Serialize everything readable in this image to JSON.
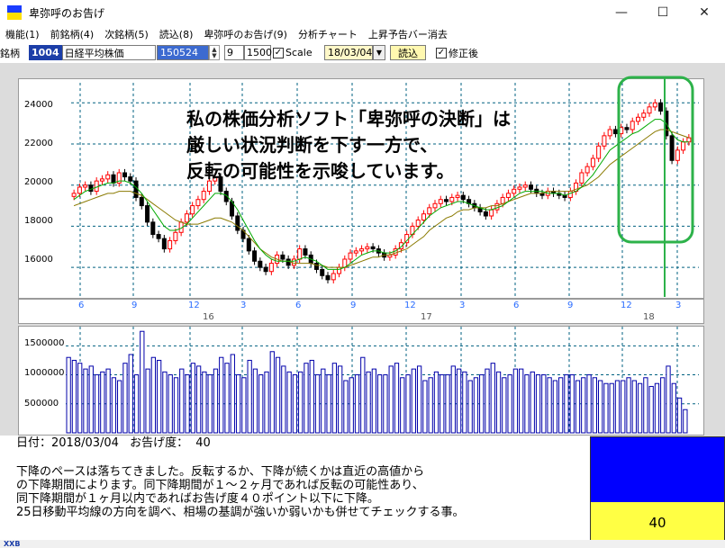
{
  "window": {
    "title": "卑弥呼のお告げ",
    "minimize": "—",
    "maximize": "☐",
    "close": "✕",
    "icon": "app-icon",
    "colors": {
      "top": "#1a3cff",
      "bottom": "#ffe000"
    }
  },
  "menu": [
    "機能(1)",
    "前銘柄(4)",
    "次銘柄(5)",
    "読込(8)",
    "卑弥呼のお告げ(9)",
    "分析チャート",
    "上昇予告バー消去"
  ],
  "toolbar": {
    "label": "銘柄",
    "code": "1004",
    "name": "日経平均株価",
    "selected": "150524",
    "field1": "9",
    "field2": "1500",
    "scale_checked": true,
    "scale_label": "Scale",
    "date": "18/03/04",
    "load_button": "読込",
    "adjust_checked": true,
    "adjust_label": "修正後"
  },
  "chart_data": {
    "type": "candlestick",
    "price_axis": {
      "ticks": [
        "24000",
        "22000",
        "20000",
        "18000",
        "16000"
      ],
      "range": [
        15000,
        24800
      ]
    },
    "month_ticks": [
      "6",
      "9",
      "12",
      "3",
      "6",
      "9",
      "12",
      "3",
      "6",
      "9",
      "12",
      "3"
    ],
    "year_ticks": [
      "16",
      "17",
      "18"
    ],
    "volume_axis": {
      "ticks": [
        "1500000",
        "1000000",
        "500000"
      ]
    },
    "colors": {
      "up": "#ff0000",
      "down": "#000000",
      "ma_short": "#00aa00",
      "ma_long": "#8a7a00",
      "grid": "#006080",
      "volume": "#0000aa",
      "marker": "#2db24a"
    },
    "overlay_text": [
      "私の株価分析ソフト「卑弥呼の決断」は",
      "厳しい状況判断を下す一方で、",
      "反転の可能性を示唆しています。"
    ],
    "price_series": [
      19600,
      19900,
      20000,
      19700,
      20200,
      20300,
      20500,
      20100,
      20600,
      20400,
      20200,
      19400,
      19000,
      18200,
      17600,
      17400,
      16900,
      17300,
      17700,
      18200,
      18600,
      19000,
      19300,
      19700,
      20200,
      20400,
      19700,
      19200,
      18500,
      17800,
      17400,
      16800,
      16300,
      16000,
      15800,
      16200,
      16600,
      16400,
      16100,
      16400,
      16900,
      16600,
      16200,
      15900,
      15600,
      15400,
      15700,
      16000,
      16400,
      16700,
      16800,
      16900,
      17000,
      16900,
      16700,
      16500,
      16600,
      16900,
      17200,
      17600,
      18000,
      18300,
      18600,
      18900,
      19100,
      19300,
      19200,
      19400,
      19500,
      19300,
      19100,
      18900,
      18700,
      18500,
      18800,
      19100,
      19400,
      19600,
      19800,
      19900,
      20000,
      19800,
      19600,
      19500,
      19700,
      19600,
      19500,
      19400,
      19700,
      20100,
      20600,
      20900,
      21300,
      21900,
      22400,
      22700,
      22500,
      22800,
      22700,
      23100,
      23300,
      23500,
      23800,
      24000,
      23600,
      22400,
      21200,
      21700,
      22100,
      22300
    ],
    "ma_short": [
      19300,
      19500,
      19700,
      19800,
      19900,
      20000,
      20100,
      20100,
      20200,
      20200,
      20100,
      19900,
      19600,
      19200,
      18800,
      18400,
      18000,
      17800,
      17800,
      17900,
      18100,
      18400,
      18700,
      19000,
      19300,
      19600,
      19600,
      19500,
      19200,
      18800,
      18300,
      17800,
      17300,
      16900,
      16600,
      16400,
      16300,
      16300,
      16300,
      16300,
      16400,
      16500,
      16400,
      16300,
      16100,
      15900,
      15900,
      15900,
      16000,
      16200,
      16400,
      16600,
      16700,
      16800,
      16800,
      16700,
      16700,
      16800,
      17000,
      17300,
      17600,
      17900,
      18200,
      18500,
      18700,
      18900,
      19000,
      19100,
      19200,
      19200,
      19100,
      19000,
      18900,
      18800,
      18800,
      18900,
      19000,
      19200,
      19400,
      19600,
      19700,
      19700,
      19700,
      19700,
      19600,
      19600,
      19600,
      19500,
      19600,
      19700,
      19900,
      20200,
      20500,
      20900,
      21300,
      21700,
      21900,
      22100,
      22300,
      22500,
      22600,
      22800,
      23000,
      23200,
      23200,
      23000,
      22500,
      22200,
      22100,
      22100
    ],
    "ma_long": [
      19000,
      19100,
      19200,
      19300,
      19400,
      19500,
      19600,
      19600,
      19700,
      19700,
      19700,
      19600,
      19500,
      19300,
      19100,
      18900,
      18700,
      18500,
      18300,
      18200,
      18100,
      18100,
      18100,
      18200,
      18300,
      18400,
      18400,
      18300,
      18200,
      18000,
      17800,
      17500,
      17200,
      16900,
      16700,
      16500,
      16400,
      16300,
      16300,
      16200,
      16200,
      16200,
      16200,
      16100,
      16100,
      16000,
      16000,
      16000,
      16000,
      16100,
      16200,
      16300,
      16400,
      16500,
      16500,
      16600,
      16600,
      16700,
      16800,
      16900,
      17100,
      17300,
      17500,
      17800,
      18000,
      18200,
      18400,
      18500,
      18700,
      18800,
      18800,
      18900,
      18900,
      18900,
      19000,
      19000,
      19100,
      19200,
      19300,
      19400,
      19500,
      19600,
      19600,
      19600,
      19700,
      19700,
      19700,
      19700,
      19700,
      19800,
      19900,
      20000,
      20200,
      20400,
      20700,
      21000,
      21200,
      21400,
      21600,
      21800,
      22000,
      22200,
      22400,
      22600,
      22700,
      22700,
      22600,
      22500,
      22400,
      22300
    ],
    "volume_series": [
      1300000,
      1250000,
      1200000,
      1100000,
      1150000,
      1000000,
      1050000,
      1100000,
      950000,
      900000,
      1200000,
      1350000,
      1000000,
      1750000,
      1100000,
      1300000,
      1250000,
      1050000,
      1000000,
      950000,
      1100000,
      1000000,
      1200000,
      1150000,
      1050000,
      1000000,
      1100000,
      1300000,
      1200000,
      1350000,
      1000000,
      950000,
      1250000,
      1100000,
      1000000,
      1050000,
      1400000,
      1300000,
      1150000,
      1050000,
      1000000,
      1050000,
      1200000,
      1250000,
      1000000,
      1100000,
      1000000,
      1200000,
      1150000,
      900000,
      950000,
      1000000,
      1300000,
      1050000,
      1100000,
      1000000,
      1000000,
      1150000,
      1200000,
      950000,
      1000000,
      1100000,
      1150000,
      900000,
      950000,
      1050000,
      1000000,
      1000000,
      1150000,
      1100000,
      1050000,
      900000,
      950000,
      1000000,
      1100000,
      1200000,
      1050000,
      950000,
      1000000,
      1100000,
      1100000,
      1000000,
      1050000,
      1000000,
      1000000,
      950000,
      900000,
      950000,
      1000000,
      1000000,
      900000,
      950000,
      1000000,
      950000,
      900000,
      850000,
      850000,
      900000,
      900000,
      950000,
      900000,
      850000,
      950000,
      800000,
      850000,
      950000,
      1150000,
      850000,
      600000,
      400000
    ]
  },
  "info": {
    "date_label": "日付：2018/03/04",
    "level_label": "お告げ度：",
    "level_value": "40",
    "description": [
      "下降のペースは落ちてきました。反転するか、下降が続くかは直近の高値から",
      "の下降期間によります。同下降期間が１～２ヶ月であれば反転の可能性あり、",
      "同下降期間が１ヶ月以内であればお告げ度４０ポイント以下に下降。",
      "25日移動平均線の方向を調べ、相場の基調が強いか弱いかも併せてチェックする事。"
    ],
    "score": "40",
    "score_colors": {
      "top": "#0000ff",
      "bottom": "#ffff44"
    }
  },
  "bottom": {
    "tag": "XXB"
  }
}
